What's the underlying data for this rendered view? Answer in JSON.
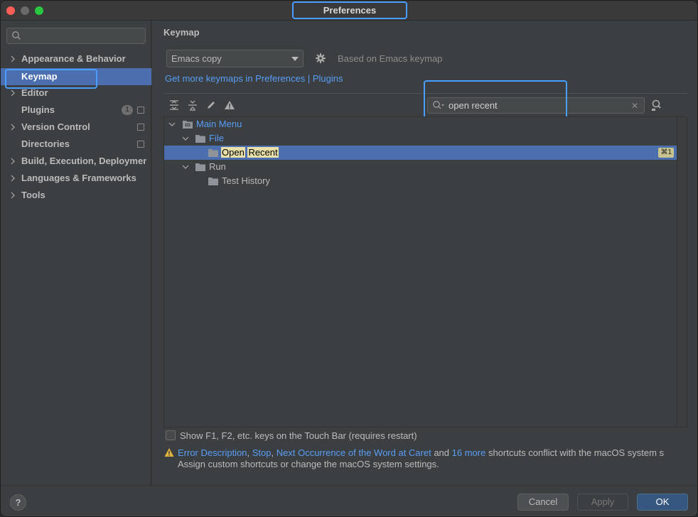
{
  "window": {
    "title": "Preferences"
  },
  "sidebar": {
    "search_value": "",
    "items": [
      {
        "label": "Appearance & Behavior",
        "expandable": true
      },
      {
        "label": "Keymap",
        "expandable": false,
        "selected": true
      },
      {
        "label": "Editor",
        "expandable": true
      },
      {
        "label": "Plugins",
        "expandable": false,
        "badge": "1"
      },
      {
        "label": "Version Control",
        "expandable": true
      },
      {
        "label": "Directories",
        "expandable": false
      },
      {
        "label": "Build, Execution, Deployment",
        "expandable": true
      },
      {
        "label": "Languages & Frameworks",
        "expandable": true
      },
      {
        "label": "Tools",
        "expandable": true
      }
    ]
  },
  "main": {
    "title": "Keymap",
    "keymap_select": "Emacs copy",
    "based_on": "Based on Emacs keymap",
    "get_more": "Get more keymaps in Preferences | Plugins",
    "filter_value": "open recent",
    "tree": {
      "main_menu": "Main Menu",
      "file": "File",
      "open": "Open",
      "recent": "Recent",
      "open_recent_shortcut": "⌘1",
      "run": "Run",
      "test_history": "Test History"
    },
    "touchbar_label": "Show F1, F2, etc. keys on the Touch Bar (requires restart)",
    "warning": {
      "link1": "Error Description",
      "sep1": ", ",
      "link2": "Stop",
      "sep2": ", ",
      "link3": "Next Occurrence of the Word at Caret",
      "and": " and ",
      "link4": "16 more",
      "tail": " shortcuts conflict with the macOS system s",
      "line2": "Assign custom shortcuts or change the macOS system settings."
    }
  },
  "footer": {
    "help": "?",
    "cancel": "Cancel",
    "apply": "Apply",
    "ok": "OK"
  },
  "colors": {
    "accent": "#4b6eaf",
    "link": "#589df6",
    "highlight_box": "#4a9eff"
  }
}
